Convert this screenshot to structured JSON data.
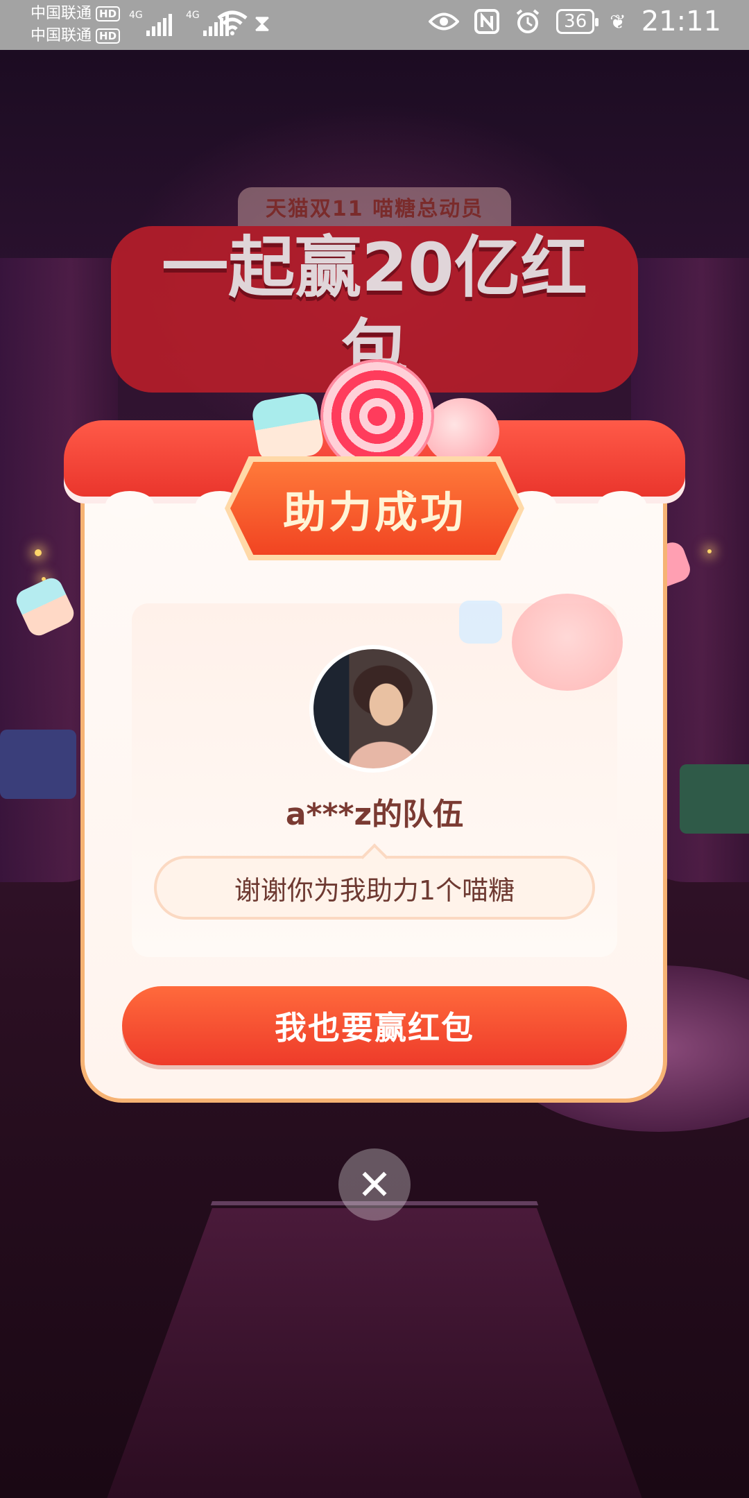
{
  "status_bar": {
    "carrier_1": "中国联通",
    "carrier_2": "中国联通",
    "hd_label": "HD",
    "network_1": "4G",
    "network_2": "4G",
    "battery": "36",
    "time": "21:11",
    "icons": [
      "signal-icon",
      "wifi-icon",
      "hourglass-icon",
      "eye-icon",
      "nfc-icon",
      "alarm-icon",
      "battery-icon",
      "leaf-icon"
    ]
  },
  "banner": {
    "subtitle": "天猫双11 喵糖总动员",
    "title": "一起赢20亿红包"
  },
  "modal": {
    "badge": "助力成功",
    "team_name": "a***z的队伍",
    "message": "谢谢你为我助力1个喵糖",
    "cta_label": "我也要赢红包",
    "close_icon": "close-icon"
  },
  "colors": {
    "accent": "#ee3b2a",
    "modal_border": "#f6b374",
    "text_brown": "#7a3a32"
  }
}
